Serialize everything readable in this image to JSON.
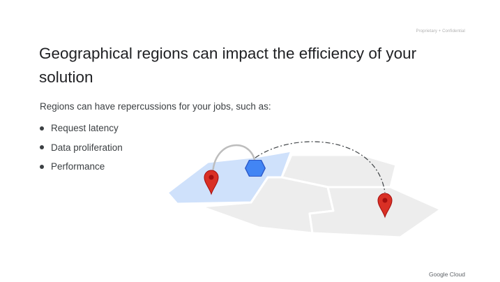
{
  "slide": {
    "confidential_label": "Proprietary + Confidential",
    "title": "Geographical regions can impact the efficiency of your solution",
    "intro": "Regions can have repercussions for your jobs, such as:",
    "bullets": [
      {
        "label": "Request latency"
      },
      {
        "label": "Data proliferation"
      },
      {
        "label": "Performance"
      }
    ],
    "brand": "Google Cloud"
  },
  "map": {
    "icons": [
      "map-pin-icon",
      "hexagon-node-icon",
      "map-pin-icon"
    ],
    "colors": {
      "land": "#ededed",
      "border": "#ffffff",
      "highlight_region": "#cfe1fb",
      "pin": "#d93025",
      "pin_dark": "#a50e0e",
      "hexagon": "#4285f4",
      "arc_solid": "#bdbdbd",
      "arc_dashed": "#3c4043"
    }
  }
}
